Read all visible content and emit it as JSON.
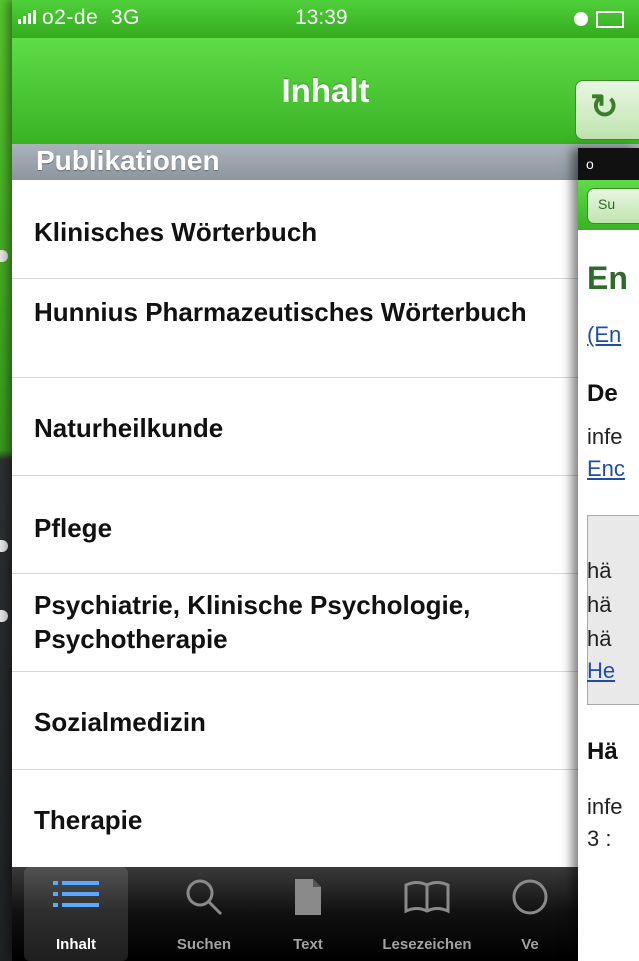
{
  "status_bar": {
    "carrier": "o2-de",
    "network": "3G",
    "time": "13:39"
  },
  "nav": {
    "title": "Inhalt",
    "refresh_icon": "refresh-icon"
  },
  "section": {
    "header": "Publikationen"
  },
  "publications": [
    "Klinisches Wörterbuch",
    "Hunnius Pharmazeutisches Wörterbuch",
    "Naturheilkunde",
    "Pflege",
    "Psychiatrie, Klinische Psychologie, Psychotherapie",
    "Sozialmedizin",
    "Therapie"
  ],
  "tabs": [
    {
      "label": "Inhalt",
      "icon": "list-icon",
      "active": true
    },
    {
      "label": "Suchen",
      "icon": "search-icon",
      "active": false
    },
    {
      "label": "Text",
      "icon": "document-icon",
      "active": false
    },
    {
      "label": "Lesezeichen",
      "icon": "book-icon",
      "active": false
    },
    {
      "label": "Ve",
      "icon": "clock-icon",
      "active": false
    }
  ],
  "overlay": {
    "status_carrier": "o",
    "nav_button": "Su",
    "heading": "En",
    "link": "(En",
    "def_heading": "De",
    "text_lines": [
      "infe",
      "Enc"
    ],
    "box_lines": [
      "hä",
      "hä",
      "hä",
      "He"
    ],
    "section_heading": "Hä",
    "footer_lines": [
      "infe",
      "3 :"
    ]
  },
  "colors": {
    "accent_green": "#3fbf28",
    "section_gray": "#949da6",
    "tabbar_dark": "#111111"
  }
}
